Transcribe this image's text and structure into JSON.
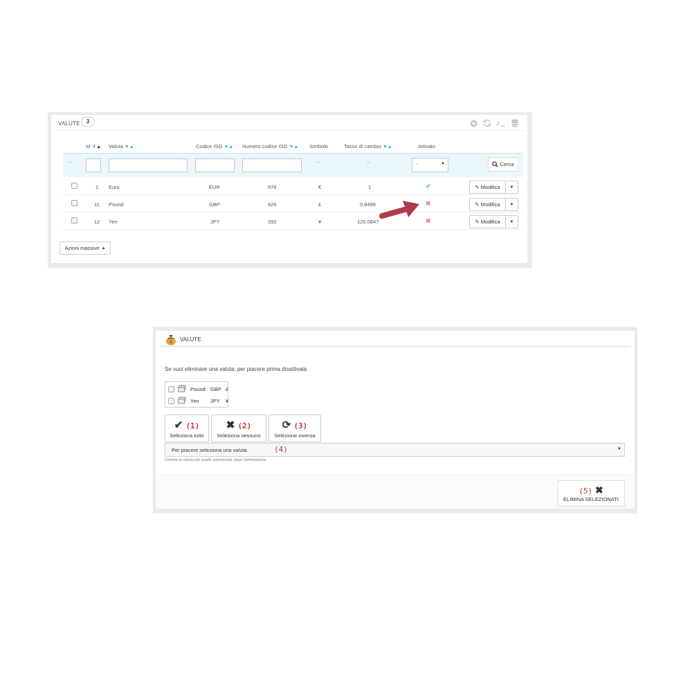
{
  "panel1": {
    "title": "VALUTE",
    "count": "3",
    "header_icons": [
      "add-icon",
      "refresh-icon",
      "terminal-icon",
      "database-icon"
    ],
    "columns": [
      {
        "label": "Id",
        "sortable": true
      },
      {
        "label": "Valuta",
        "sortable": true
      },
      {
        "label": "Codice ISO",
        "sortable": true
      },
      {
        "label": "Numero codice ISO",
        "sortable": true
      },
      {
        "label": "Simbolo",
        "sortable": false
      },
      {
        "label": "Tasso di cambio",
        "sortable": true
      },
      {
        "label": "Attivato",
        "sortable": false
      }
    ],
    "filter": {
      "dash": "--",
      "active_select": "-",
      "search_label": "Cerca"
    },
    "rows": [
      {
        "id": "1",
        "name": "Euro",
        "iso": "EUR",
        "iso_num": "978",
        "symbol": "€",
        "rate": "1",
        "active": true,
        "edit_label": "Modifica"
      },
      {
        "id": "11",
        "name": "Pound",
        "iso": "GBP",
        "iso_num": "826",
        "symbol": "£",
        "rate": "0.8499",
        "active": false,
        "edit_label": "Modifica"
      },
      {
        "id": "12",
        "name": "Yen",
        "iso": "JPY",
        "iso_num": "392",
        "symbol": "¥",
        "rate": "120.0847",
        "active": false,
        "edit_label": "Modifica"
      }
    ],
    "bulk_label": "Azioni massive"
  },
  "panel2": {
    "title": "VALUTE",
    "message": "Se vuoi eliminare una valuta, per piacere prima disattivala.",
    "currencies": [
      {
        "name": "Pound",
        "iso": "GBP",
        "symbol": "£"
      },
      {
        "name": "Yen",
        "iso": "JPY",
        "symbol": "¥"
      }
    ],
    "buttons": [
      {
        "label": "Seleziona tutto",
        "number": "(1)"
      },
      {
        "label": "Seleziona nessuno",
        "number": "(2)"
      },
      {
        "label": "Selezione inversa",
        "number": "(3)"
      }
    ],
    "select_placeholder": "Per piacere seleziona una valuta.",
    "select_number": "(4)",
    "help_text": "Cambia la valuta con quella selezionata, dopo l'eliminazione.",
    "delete_label": "ELIMINA SELEZIONATI",
    "delete_number": "(5)"
  },
  "colors": {
    "accent": "#25b9d7",
    "arrow": "#b23a48",
    "check": "#72c279",
    "cross": "#e08a8a",
    "annotation": "#c0392b"
  }
}
